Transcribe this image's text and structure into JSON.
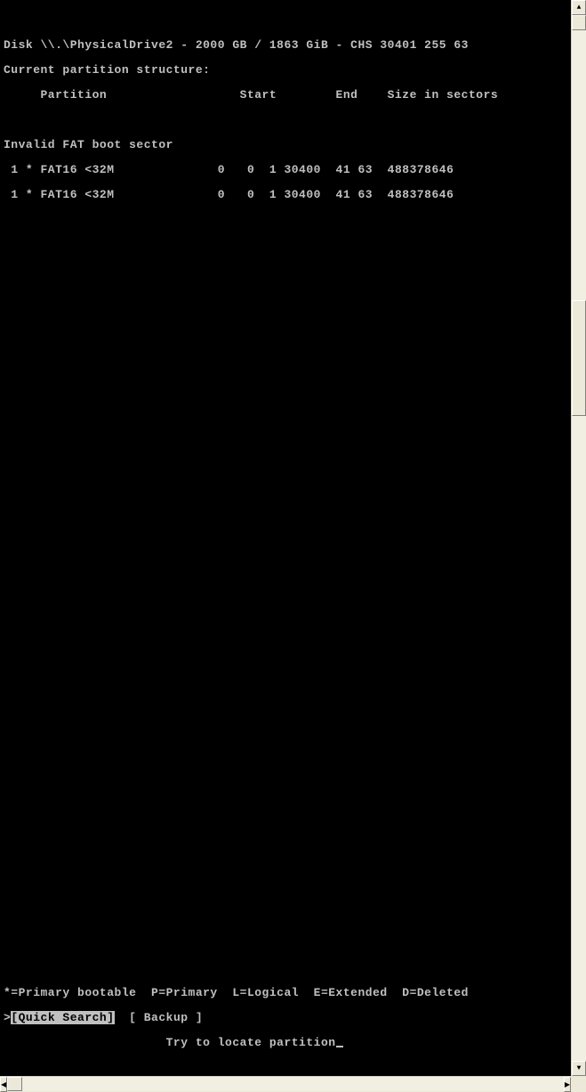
{
  "terminal": {
    "blank": "",
    "disk_info": "Disk \\\\.\\PhysicalDrive2 - 2000 GB / 1863 GiB - CHS 30401 255 63",
    "structure_label": "Current partition structure:",
    "header": "     Partition                  Start        End    Size in sectors",
    "invalid": "Invalid FAT boot sector",
    "row1": " 1 * FAT16 <32M              0   0  1 30400  41 63  488378646",
    "row2": " 1 * FAT16 <32M              0   0  1 30400  41 63  488378646",
    "legend": "*=Primary bootable  P=Primary  L=Logical  E=Extended  D=Deleted",
    "menu_prefix": ">",
    "menu_quick": "[Quick Search]",
    "menu_gap": "  ",
    "menu_backup": "[ Backup ]",
    "hint": "                      Try to locate partition"
  }
}
